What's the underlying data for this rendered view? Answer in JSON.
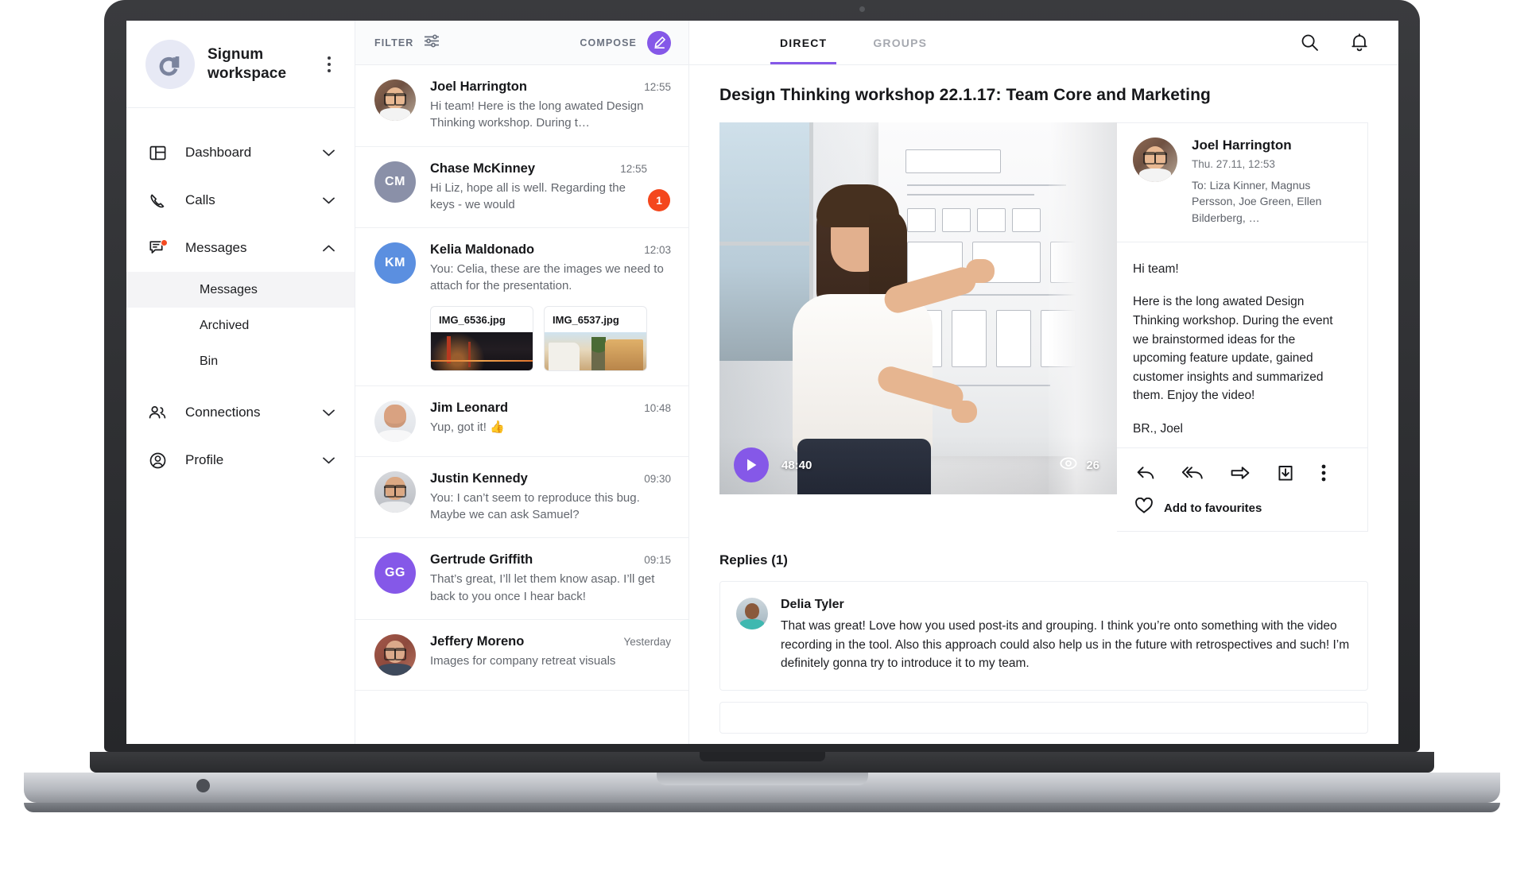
{
  "workspace": {
    "name": "Signum\nworkspace",
    "logo_icon": "signum-logo-icon",
    "menu_icon": "more-vertical-icon"
  },
  "sidebar": {
    "items": [
      {
        "label": "Dashboard",
        "icon": "dashboard-icon",
        "chevron": "chevron-down-icon",
        "badge": false
      },
      {
        "label": "Calls",
        "icon": "phone-icon",
        "chevron": "chevron-down-icon",
        "badge": false
      },
      {
        "label": "Messages",
        "icon": "message-icon",
        "chevron": "chevron-up-icon",
        "badge": true
      },
      {
        "label": "Connections",
        "icon": "people-icon",
        "chevron": "chevron-down-icon",
        "badge": false
      },
      {
        "label": "Profile",
        "icon": "user-circle-icon",
        "chevron": "chevron-down-icon",
        "badge": false
      }
    ],
    "messages_sub": [
      {
        "label": "Messages",
        "active": true
      },
      {
        "label": "Archived",
        "active": false
      },
      {
        "label": "Bin",
        "active": false
      }
    ]
  },
  "topbar": {
    "tabs": [
      {
        "label": "DIRECT",
        "active": true
      },
      {
        "label": "GROUPS",
        "active": false
      }
    ],
    "search_icon": "search-icon",
    "notifications_icon": "bell-icon"
  },
  "list_toolbar": {
    "filter_label": "FILTER",
    "filter_icon": "sliders-icon",
    "compose_label": "COMPOSE",
    "compose_icon": "pencil-icon",
    "compose_color": "#8558e8"
  },
  "conversations": [
    {
      "name": "Joel Harrington",
      "time": "12:55",
      "preview": "Hi team! Here is the long awated Design Thinking workshop. During t…",
      "avatar_type": "photo",
      "avatar_class": "ph-joel",
      "glasses": true,
      "unread": null
    },
    {
      "name": "Chase McKinney",
      "time": "12:55",
      "preview": "Hi Liz, hope all is well. Regarding the keys - we would",
      "avatar_type": "initials",
      "initials": "CM",
      "avatar_color": "#8a90a8",
      "unread": "1"
    },
    {
      "name": "Kelia Maldonado",
      "time": "12:03",
      "preview": "You: Celia, these are the images we need to attach for the presentation.",
      "avatar_type": "initials",
      "initials": "KM",
      "avatar_color": "#5b8fe0",
      "unread": null,
      "attachments": [
        {
          "filename": "IMG_6536.jpg",
          "thumb": "bridge-night-thumb"
        },
        {
          "filename": "IMG_6537.jpg",
          "thumb": "street-houses-thumb"
        }
      ]
    },
    {
      "name": "Jim Leonard",
      "time": "10:48",
      "preview": "Yup, got it! 👍",
      "avatar_type": "photo",
      "avatar_class": "ph-jim",
      "glasses": false,
      "unread": null
    },
    {
      "name": "Justin Kennedy",
      "time": "09:30",
      "preview": "You: I can’t seem to reproduce this bug. Maybe we can ask Samuel?",
      "avatar_type": "photo",
      "avatar_class": "ph-justin",
      "glasses": true,
      "unread": null
    },
    {
      "name": "Gertrude Griffith",
      "time": "09:15",
      "preview": "That’s great, I’ll let them know asap. I’ll get back to you once I hear back!",
      "avatar_type": "initials",
      "initials": "GG",
      "avatar_color": "#8558e8",
      "unread": null
    },
    {
      "name": "Jeffery Moreno",
      "time": "Yesterday",
      "preview": "Images for company retreat visuals",
      "avatar_type": "photo",
      "avatar_class": "ph-jeffery",
      "glasses": true,
      "unread": null
    }
  ],
  "thread": {
    "title": "Design Thinking workshop 22.1.17: Team Core and Marketing",
    "video": {
      "duration": "48:40",
      "views": "26",
      "play_icon": "play-icon",
      "views_icon": "eye-icon",
      "accent": "#8558e8"
    },
    "message": {
      "sender": "Joel Harrington",
      "date": "Thu. 27.11, 12:53",
      "recipients": "To: Liza Kinner, Magnus Persson, Joe Green, Ellen Bilderberg, …",
      "paragraphs": [
        "Hi team!",
        "Here is the long awated Design Thinking workshop. During the event we brainstormed ideas for the upcoming feature update, gained customer insights and summarized them. Enjoy the video!",
        "BR., Joel"
      ],
      "actions": [
        {
          "name": "reply-icon",
          "title": "Reply"
        },
        {
          "name": "reply-all-icon",
          "title": "Reply all"
        },
        {
          "name": "forward-icon",
          "title": "Forward"
        },
        {
          "name": "download-icon",
          "title": "Download"
        },
        {
          "name": "more-vertical-icon",
          "title": "More"
        }
      ],
      "favourite_label": "Add to favourites",
      "favourite_icon": "heart-icon"
    },
    "replies_title": "Replies (1)",
    "replies": [
      {
        "name": "Delia Tyler",
        "text": "That was great! Love how you used post-its and grouping. I think you’re onto something with the video recording in the tool. Also this approach could also help us in the future with retrospectives and such! I’m definitely gonna try to introduce it to my team."
      }
    ]
  }
}
